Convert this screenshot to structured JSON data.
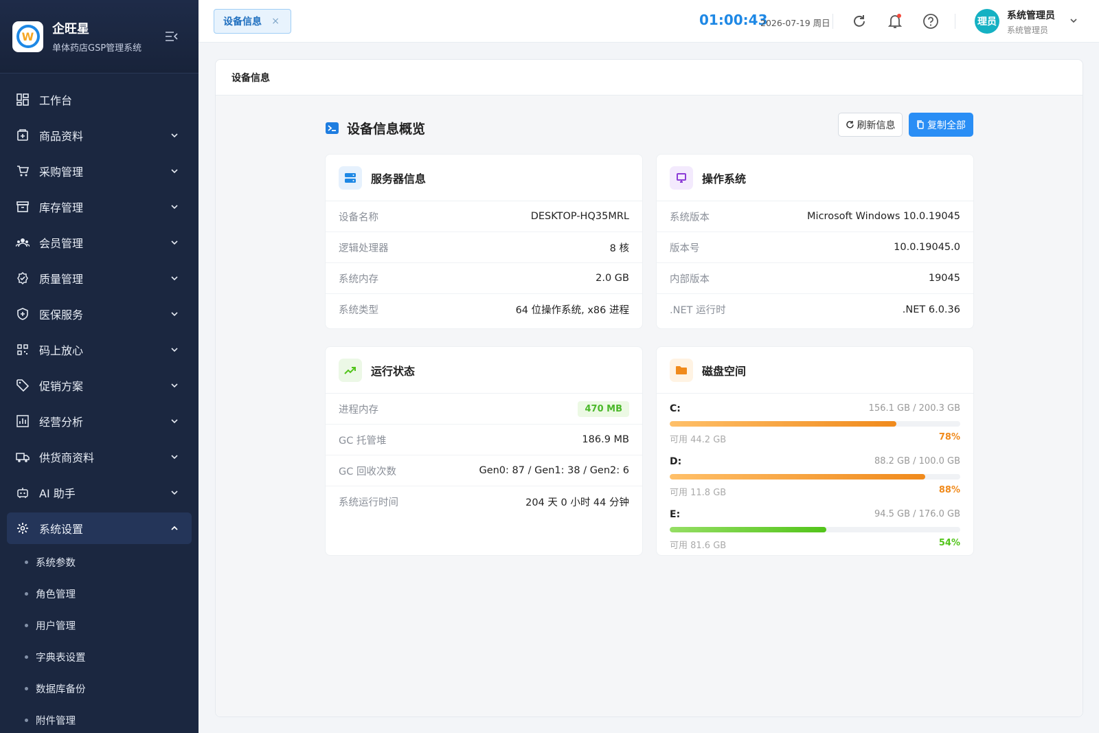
{
  "brand": {
    "name": "企旺星",
    "subtitle": "单体药店GSP管理系统"
  },
  "sidebar": {
    "items": [
      {
        "label": "工作台",
        "icon": "dashboard-icon"
      },
      {
        "label": "商品资料",
        "icon": "product-icon"
      },
      {
        "label": "采购管理",
        "icon": "cart-icon"
      },
      {
        "label": "库存管理",
        "icon": "inventory-icon"
      },
      {
        "label": "会员管理",
        "icon": "members-icon"
      },
      {
        "label": "质量管理",
        "icon": "quality-icon"
      },
      {
        "label": "医保服务",
        "icon": "shield-icon"
      },
      {
        "label": "码上放心",
        "icon": "qrcode-icon"
      },
      {
        "label": "促销方案",
        "icon": "tag-icon"
      },
      {
        "label": "经营分析",
        "icon": "chart-icon"
      },
      {
        "label": "供货商资料",
        "icon": "truck-icon"
      },
      {
        "label": "AI 助手",
        "icon": "robot-icon"
      },
      {
        "label": "系统设置",
        "icon": "gear-icon"
      }
    ],
    "submenu": [
      "系统参数",
      "角色管理",
      "用户管理",
      "字典表设置",
      "数据库备份",
      "附件管理"
    ]
  },
  "header": {
    "tab_label": "设备信息",
    "tab_close": "×",
    "clock": "01:00:43",
    "date": "2026-07-19 周日",
    "avatar_text": "理员",
    "user_name": "系统管理员",
    "user_role": "系统管理员"
  },
  "panel": {
    "title": "设备信息",
    "overview_title": "设备信息概览",
    "refresh_label": "刷新信息",
    "copy_label": "复制全部"
  },
  "server": {
    "title": "服务器信息",
    "rows": [
      {
        "k": "设备名称",
        "v": "DESKTOP-HQ35MRL"
      },
      {
        "k": "逻辑处理器",
        "v": "8 核"
      },
      {
        "k": "系统内存",
        "v": "2.0 GB"
      },
      {
        "k": "系统类型",
        "v": "64 位操作系统, x86 进程"
      }
    ]
  },
  "os": {
    "title": "操作系统",
    "rows": [
      {
        "k": "系统版本",
        "v": "Microsoft Windows 10.0.19045"
      },
      {
        "k": "版本号",
        "v": "10.0.19045.0"
      },
      {
        "k": "内部版本",
        "v": "19045"
      },
      {
        "k": ".NET 运行时",
        "v": ".NET 6.0.36"
      }
    ]
  },
  "runtime": {
    "title": "运行状态",
    "rows": [
      {
        "k": "进程内存",
        "v": "470 MB"
      },
      {
        "k": "GC 托管堆",
        "v": "186.9 MB"
      },
      {
        "k": "GC 回收次数",
        "v": "Gen0: 87 / Gen1: 38 / Gen2: 6"
      },
      {
        "k": "系统运行时间",
        "v": "204 天 0 小时 44 分钟"
      }
    ]
  },
  "disk": {
    "title": "磁盘空间",
    "drives": [
      {
        "label": "C:",
        "usage": "156.1 GB / 200.3 GB",
        "free": "可用 44.2 GB",
        "percent": "78%",
        "fraction": 0.78,
        "color": "#f08a1c"
      },
      {
        "label": "D:",
        "usage": "88.2 GB / 100.0 GB",
        "free": "可用 11.8 GB",
        "percent": "88%",
        "fraction": 0.88,
        "color": "#f08a1c"
      },
      {
        "label": "E:",
        "usage": "94.5 GB / 176.0 GB",
        "free": "可用 81.6 GB",
        "percent": "54%",
        "fraction": 0.54,
        "color": "#52c41a"
      }
    ]
  },
  "colors": {
    "accent": "#1e88e5",
    "sidebar_bg": "#1b2740",
    "warning": "#f08a1c",
    "success": "#52c41a"
  }
}
